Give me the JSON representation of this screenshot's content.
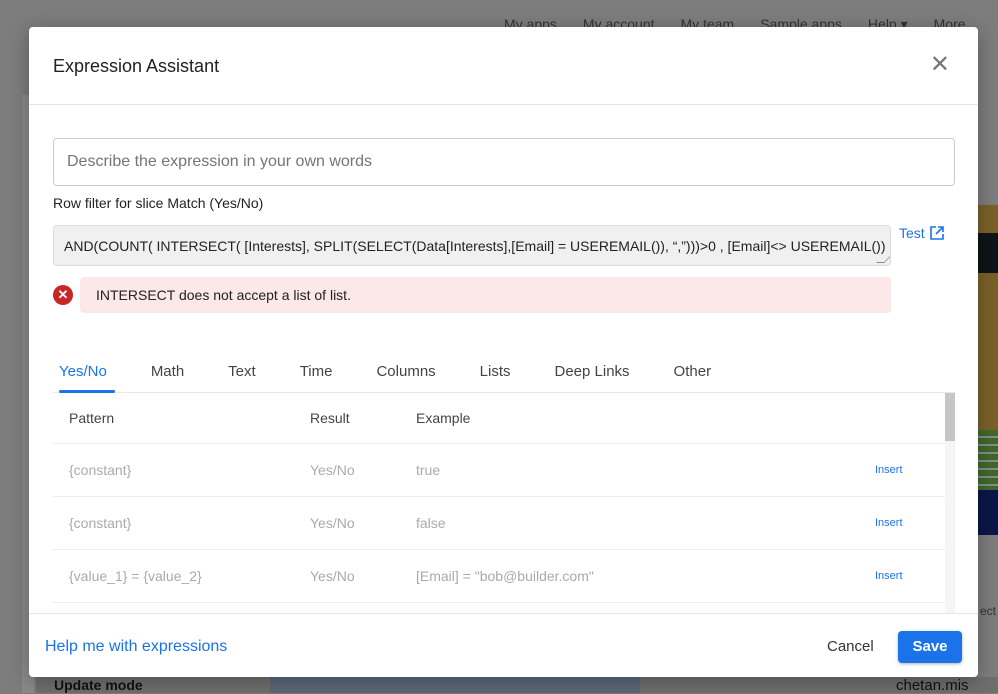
{
  "background": {
    "nav": [
      "My apps",
      "My account",
      "My team",
      "Sample apps",
      "Help ▾",
      "More"
    ],
    "side_text": "ect",
    "update_mode": "Update mode",
    "user": "chetan.mis"
  },
  "modal": {
    "title": "Expression Assistant",
    "close_icon": "close-icon",
    "description_placeholder": "Describe the expression in your own words",
    "filter_label": "Row filter for slice Match (Yes/No)",
    "expression": "AND(COUNT( INTERSECT( [Interests], SPLIT(SELECT(Data[Interests],[Email] = USEREMAIL()), “,”)))>0 , [Email]<> USEREMAIL())",
    "test_label": "Test",
    "error": "INTERSECT does not accept a list of list.",
    "error_color": "#c62828",
    "tabs": [
      {
        "label": "Yes/No",
        "active": true
      },
      {
        "label": "Math"
      },
      {
        "label": "Text"
      },
      {
        "label": "Time"
      },
      {
        "label": "Columns"
      },
      {
        "label": "Lists"
      },
      {
        "label": "Deep Links"
      },
      {
        "label": "Other"
      }
    ],
    "table": {
      "headers": [
        "Pattern",
        "Result",
        "Example"
      ],
      "rows": [
        {
          "pattern": "{constant}",
          "result": "Yes/No",
          "example": "true",
          "action": "Insert"
        },
        {
          "pattern": "{constant}",
          "result": "Yes/No",
          "example": "false",
          "action": "Insert"
        },
        {
          "pattern": "{value_1} = {value_2}",
          "result": "Yes/No",
          "example": "[Email] = \"bob@builder.com\"",
          "action": "Insert"
        }
      ]
    },
    "help_link": "Help me with expressions",
    "cancel_label": "Cancel",
    "save_label": "Save",
    "accent": "#1a73e8"
  }
}
